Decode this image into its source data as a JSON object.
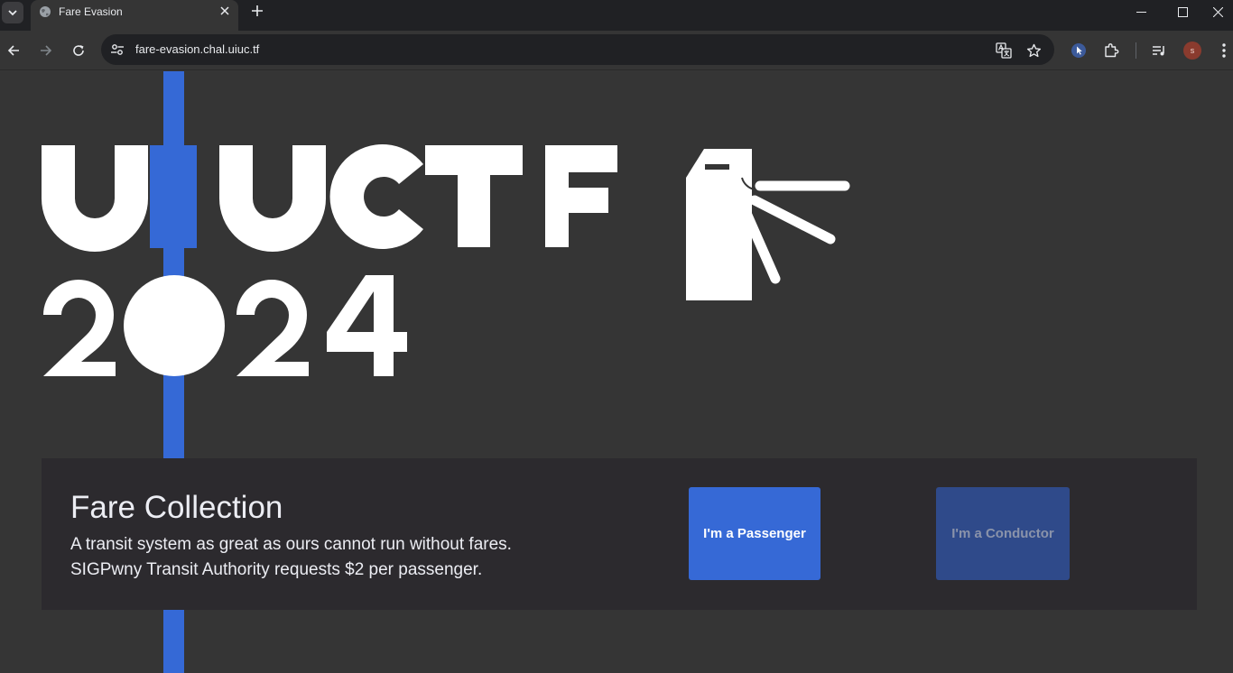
{
  "browser": {
    "tab_title": "Fare Evasion",
    "url": "fare-evasion.chal.uiuc.tf",
    "profile_initial": "s",
    "icons": [
      "tab-search-icon",
      "globe-icon",
      "close-icon",
      "plus-icon",
      "minimize-icon",
      "maximize-icon",
      "close-window-icon",
      "back-icon",
      "forward-icon",
      "reload-icon",
      "site-settings-icon",
      "translate-icon",
      "star-icon",
      "extension-cursor-icon",
      "puzzle-icon",
      "media-queue-icon",
      "more-vertical-icon"
    ]
  },
  "logo": {
    "line1": "UIUCTF",
    "line2": "2024",
    "icon": "turnstile-icon",
    "accent_color": "#3569d6"
  },
  "panel": {
    "title": "Fare Collection",
    "desc_line1": "A transit system as great as ours cannot run without fares.",
    "desc_line2": "SIGPwny Transit Authority requests $2 per passenger.",
    "passenger_button": "I'm a Passenger",
    "conductor_button": "I'm a Conductor"
  },
  "colors": {
    "page_bg": "#353535",
    "panel_bg": "#2c2a2e",
    "primary": "#3669d6",
    "disabled": "#2f4a8a"
  }
}
